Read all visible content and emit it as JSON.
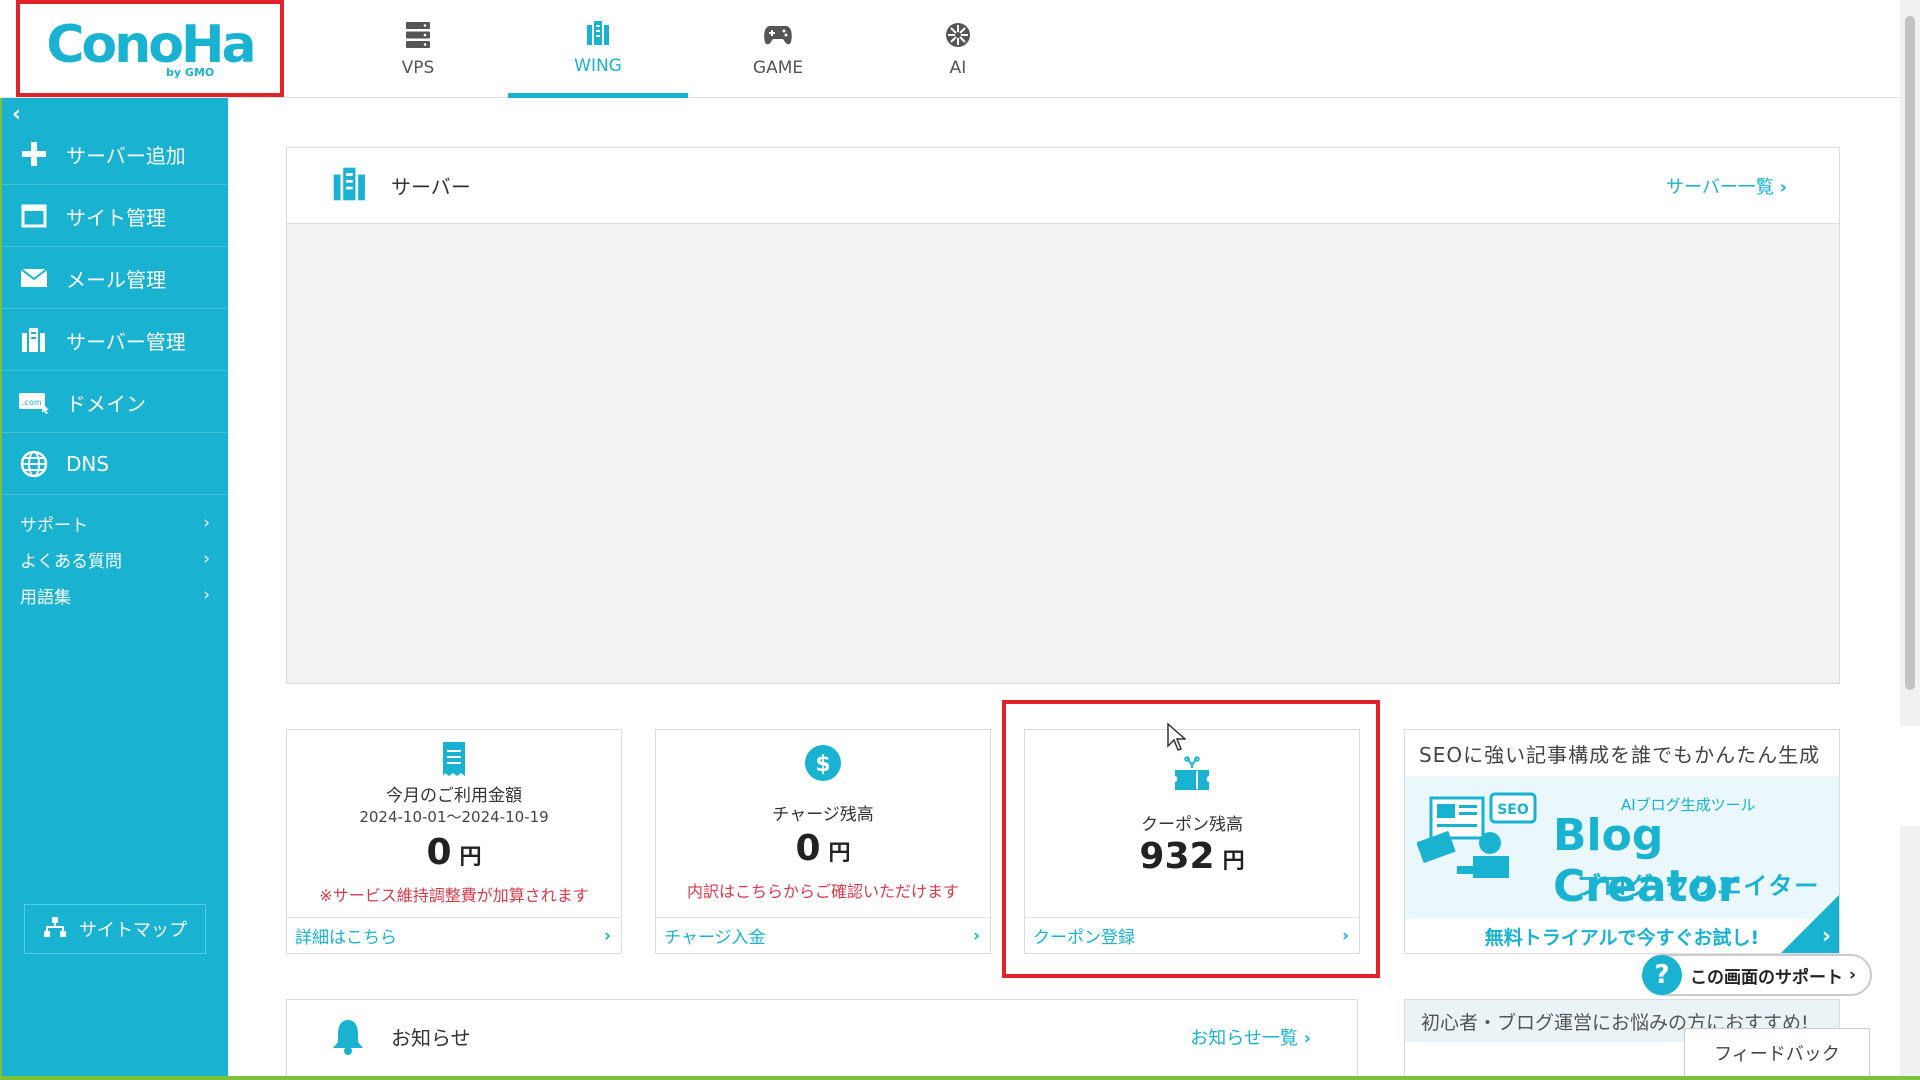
{
  "top_nav": {
    "logo_text": "ConoHa",
    "logo_sub": "by GMO",
    "tabs": [
      {
        "label": "VPS",
        "icon": "server-stack-icon"
      },
      {
        "label": "WING",
        "icon": "wing-server-icon",
        "active": true
      },
      {
        "label": "GAME",
        "icon": "gamepad-icon"
      },
      {
        "label": "AI",
        "icon": "ai-icon"
      }
    ]
  },
  "sidebar": {
    "collapse_icon": "‹",
    "items": [
      {
        "label": "サーバー追加",
        "icon": "plus-icon"
      },
      {
        "label": "サイト管理",
        "icon": "window-icon"
      },
      {
        "label": "メール管理",
        "icon": "mail-icon"
      },
      {
        "label": "サーバー管理",
        "icon": "server-icon"
      },
      {
        "label": "ドメイン",
        "icon": "domain-icon"
      },
      {
        "label": "DNS",
        "icon": "globe-icon"
      }
    ],
    "links": [
      {
        "label": "サポート"
      },
      {
        "label": "よくある質問"
      },
      {
        "label": "用語集"
      }
    ],
    "sitemap_label": "サイトマップ"
  },
  "server_panel": {
    "title": "サーバー",
    "link_label": "サーバー一覧"
  },
  "cards": [
    {
      "title": "今月のご利用金額",
      "period": "2024-10-01〜2024-10-19",
      "amount": "0",
      "unit": "円",
      "note": "※サービス維持調整費が加算されます",
      "footer_link": "詳細はこちら"
    },
    {
      "title": "チャージ残高",
      "amount": "0",
      "unit": "円",
      "note": "内訳はこちらからご確認いただけます",
      "footer_link": "チャージ入金"
    },
    {
      "title": "クーポン残高",
      "amount": "932",
      "unit": "円",
      "footer_link": "クーポン登録"
    }
  ],
  "ad_blog_creator": {
    "headline": "SEOに強い記事構成を誰でもかんたん生成",
    "small": "AIブログ生成ツール",
    "brand": "Blog Creator",
    "brand_ja": "ブログ クリエイター",
    "cta": "無料トライアルで今すぐお試し!",
    "seo_badge": "SEO"
  },
  "support_button": {
    "label": "この画面のサポート",
    "q": "?"
  },
  "news_panel": {
    "title": "お知らせ",
    "link_label": "お知らせ一覧"
  },
  "ad_beginner": {
    "text": "初心者・ブログ運営にお悩みの方におすすめ!"
  },
  "feedback_label": "フィードバック",
  "colors": {
    "accent": "#19b3d1",
    "highlight": "#e0232b",
    "note": "#d93a4a"
  }
}
